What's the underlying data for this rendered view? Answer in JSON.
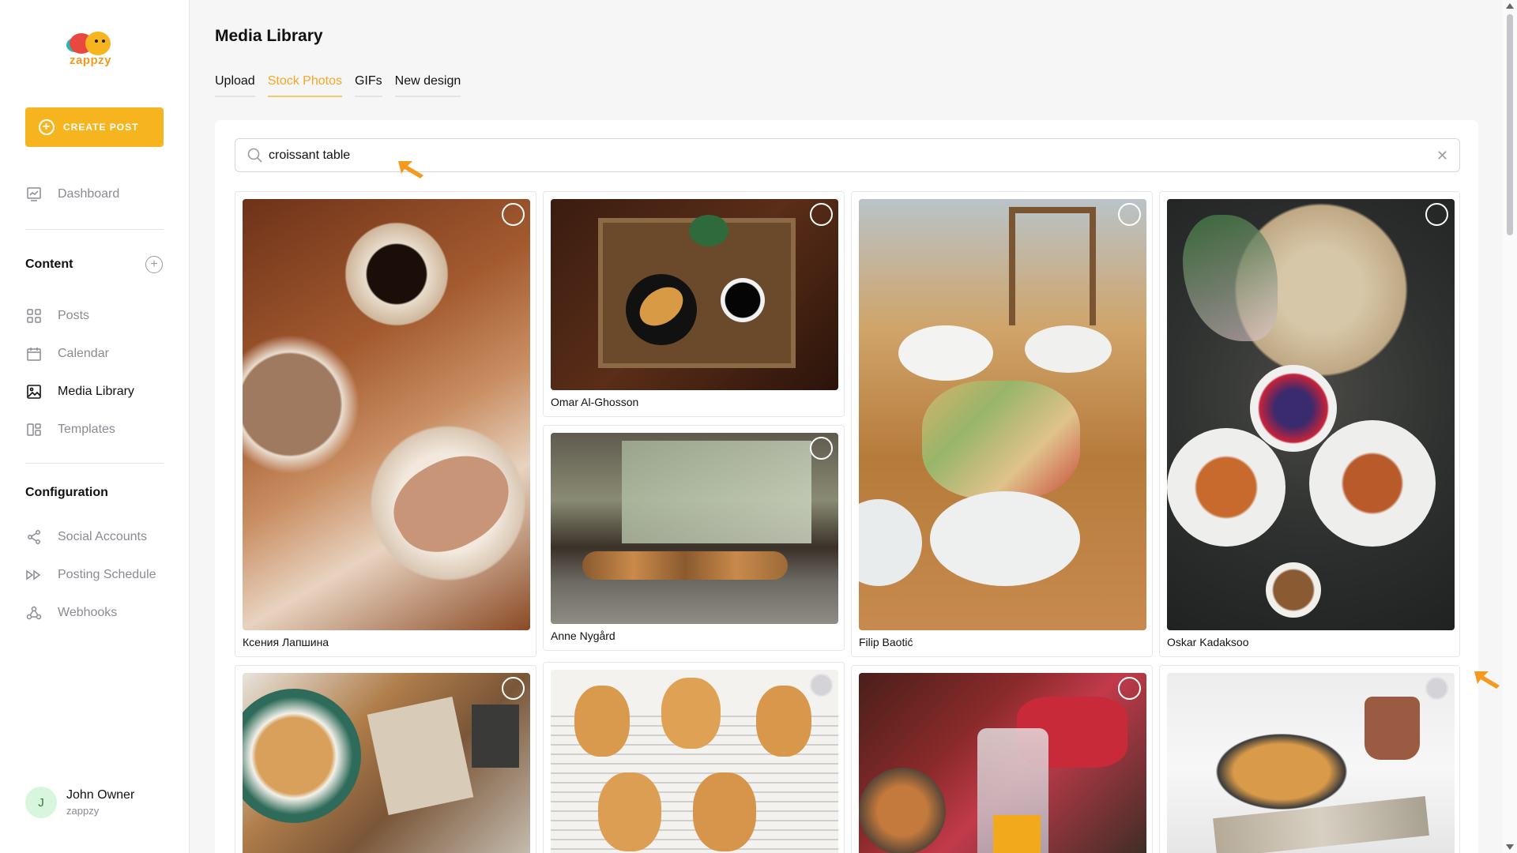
{
  "app": {
    "logo_text": "zappzy"
  },
  "sidebar": {
    "create_label": "CREATE POST",
    "dashboard_label": "Dashboard",
    "content_title": "Content",
    "content_items": [
      {
        "label": "Posts",
        "icon": "grid-icon"
      },
      {
        "label": "Calendar",
        "icon": "calendar-icon"
      },
      {
        "label": "Media Library",
        "icon": "image-icon",
        "active": true
      },
      {
        "label": "Templates",
        "icon": "templates-icon"
      }
    ],
    "config_title": "Configuration",
    "config_items": [
      {
        "label": "Social Accounts",
        "icon": "share-icon"
      },
      {
        "label": "Posting Schedule",
        "icon": "schedule-icon"
      },
      {
        "label": "Webhooks",
        "icon": "webhook-icon"
      }
    ]
  },
  "user": {
    "initial": "J",
    "name": "John Owner",
    "org": "zappzy"
  },
  "main": {
    "title": "Media Library",
    "tabs": [
      {
        "label": "Upload"
      },
      {
        "label": "Stock Photos",
        "active": true
      },
      {
        "label": "GIFs"
      },
      {
        "label": "New design"
      }
    ],
    "search": {
      "value": "croissant table",
      "clear": "✕"
    },
    "photos": [
      {
        "credit": "Ксения Лапшина"
      },
      {
        "credit": "Omar Al-Ghosson"
      },
      {
        "credit": "Anne Nygård"
      },
      {
        "credit": "Filip Baotić"
      },
      {
        "credit": "Oskar Kadaksoo"
      }
    ]
  },
  "colors": {
    "accent": "#f6b51e",
    "tab_active": "#f5a623",
    "arrow": "#f39a1f"
  }
}
